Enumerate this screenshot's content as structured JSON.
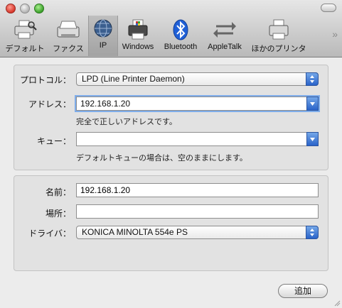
{
  "toolbar": {
    "items": [
      {
        "label": "デフォルト",
        "icon": "default-printer-icon"
      },
      {
        "label": "ファクス",
        "icon": "fax-icon"
      },
      {
        "label": "IP",
        "icon": "ip-globe-icon",
        "selected": true
      },
      {
        "label": "Windows",
        "icon": "windows-printer-icon"
      },
      {
        "label": "Bluetooth",
        "icon": "bluetooth-icon"
      },
      {
        "label": "AppleTalk",
        "icon": "appletalk-icon"
      },
      {
        "label": "ほかのプリンタ",
        "icon": "more-printers-icon"
      }
    ],
    "overflow_icon": "chevron-double-right-icon"
  },
  "protocol": {
    "label": "プロトコル：",
    "value": "LPD (Line Printer Daemon)"
  },
  "address": {
    "label": "アドレス：",
    "value": "192.168.1.20",
    "hint": "完全で正しいアドレスです。"
  },
  "queue": {
    "label": "キュー：",
    "value": "",
    "hint": "デフォルトキューの場合は、空のままにします。"
  },
  "name": {
    "label": "名前：",
    "value": "192.168.1.20"
  },
  "location": {
    "label": "場所：",
    "value": ""
  },
  "driver": {
    "label": "ドライバ：",
    "value": "KONICA MINOLTA 554e PS"
  },
  "add_button": {
    "label": "追加"
  },
  "colors": {
    "accent": "#3a78d6",
    "window": "#ececec"
  }
}
